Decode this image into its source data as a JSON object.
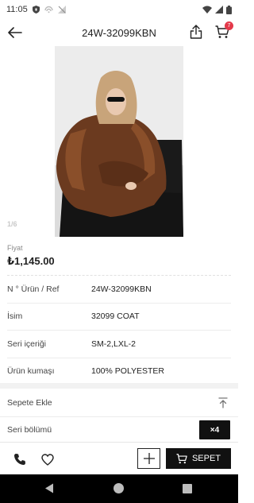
{
  "status_bar": {
    "time": "11:05",
    "icons": [
      "shield-icon",
      "hotspot-icon",
      "signal-off-icon",
      "wifi-icon",
      "cellular-icon",
      "battery-icon"
    ]
  },
  "app_bar": {
    "title": "24W-32099KBN",
    "cart_count": "7",
    "icons": [
      "arrow-left-icon",
      "share-icon",
      "cart-icon"
    ]
  },
  "product": {
    "image_alt": "Brown faux fur coat",
    "page_indicator": "1/6",
    "price_label": "Fiyat",
    "price": "₺1,145.00"
  },
  "specs": [
    {
      "key": "N ° Ürün / Ref",
      "value": "24W-32099KBN"
    },
    {
      "key": "İsim",
      "value": "32099 COAT"
    },
    {
      "key": "Seri içeriği",
      "value": "SM-2,LXL-2"
    },
    {
      "key": "Ürün kumaşı",
      "value": "100% POLYESTER"
    }
  ],
  "add_to_cart": {
    "label": "Sepete Ekle",
    "series_label": "Seri bölümü",
    "quantity": "×4"
  },
  "bottom_bar": {
    "cart_button": "SEPET",
    "icons": [
      "phone-icon",
      "heart-icon",
      "plus-icon",
      "cart-icon"
    ]
  },
  "colors": {
    "accent": "#111111",
    "badge": "#e4394a",
    "coat": "#6b3a1f"
  }
}
